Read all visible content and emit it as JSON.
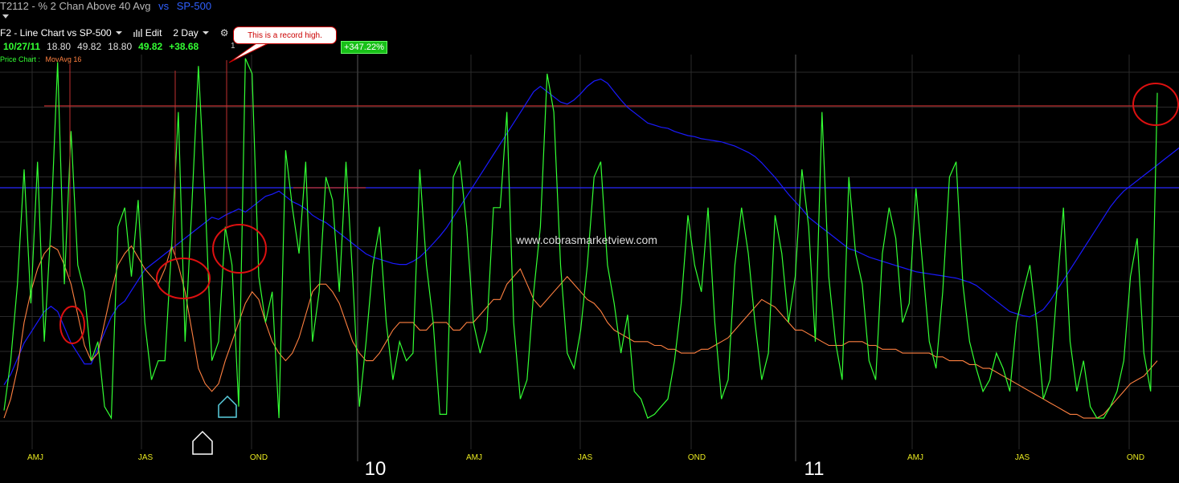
{
  "header": {
    "symbol": "T2112",
    "title": "- % 2 Chan Above 40 Avg",
    "vs": "vs",
    "compare": "SP-500"
  },
  "toolbar": {
    "chart_label": "F2 - Line Chart vs SP-500",
    "edit_label": "Edit",
    "period_label": "2 Day"
  },
  "callout": {
    "text": "This is a record high."
  },
  "quote": {
    "date": "10/27/11",
    "open": "18.80",
    "high": "49.82",
    "low": "18.80",
    "last": "49.82",
    "change": "+38.68",
    "marker": "1",
    "pct_change": "+347.22%"
  },
  "legend": {
    "series1": "Price Chart :",
    "series2": "MovAvg 16"
  },
  "watermark": "www.cobrasmarketview.com",
  "colors": {
    "indicator": "#33ff33",
    "movavg": "#ff8040",
    "sp500": "#1a1aff",
    "hline_red": "#c03030",
    "hline_blue": "#2828ff",
    "circle": "#dd1010",
    "grid": "#2a2a2a",
    "month_label": "#e8e820"
  },
  "chart_data": {
    "type": "line",
    "x_labels": [
      "AMJ",
      "JAS",
      "OND",
      "10",
      "AMJ",
      "JAS",
      "OND",
      "11",
      "AMJ",
      "JAS",
      "OND"
    ],
    "year_labels": [
      "10",
      "11"
    ],
    "series": [
      {
        "name": "% 2 Chan Above 40 Avg",
        "values": [
          7,
          20,
          40,
          70,
          35,
          72,
          25,
          55,
          98,
          40,
          80,
          45,
          38,
          20,
          25,
          8,
          5,
          55,
          60,
          42,
          62,
          30,
          15,
          20,
          20,
          50,
          85,
          25,
          60,
          97,
          62,
          20,
          25,
          55,
          45,
          8,
          99,
          95,
          42,
          30,
          38,
          5,
          75,
          60,
          48,
          72,
          25,
          38,
          68,
          62,
          38,
          72,
          42,
          8,
          25,
          45,
          55,
          30,
          15,
          25,
          20,
          22,
          70,
          45,
          30,
          6,
          6,
          68,
          72,
          55,
          30,
          22,
          28,
          60,
          60,
          85,
          30,
          10,
          15,
          38,
          55,
          95,
          85,
          45,
          22,
          18,
          28,
          45,
          68,
          72,
          45,
          35,
          22,
          32,
          12,
          10,
          5,
          6,
          8,
          10,
          20,
          35,
          58,
          45,
          38,
          60,
          30,
          10,
          15,
          45,
          60,
          48,
          30,
          15,
          22,
          58,
          48,
          30,
          42,
          70,
          55,
          25,
          85,
          42,
          25,
          15,
          68,
          48,
          40,
          20,
          15,
          48,
          60,
          52,
          30,
          35,
          65,
          45,
          25,
          18,
          38,
          68,
          72,
          40,
          25,
          18,
          12,
          15,
          22,
          18,
          12,
          30,
          38,
          45,
          30,
          10,
          15,
          38,
          60,
          25,
          12,
          20,
          8,
          5,
          5,
          8,
          12,
          20,
          42,
          52,
          22,
          12,
          90
        ],
        "color": "#33ff33"
      },
      {
        "name": "MovAvg 16",
        "values": [
          5,
          10,
          18,
          30,
          38,
          44,
          48,
          50,
          49,
          45,
          40,
          32,
          24,
          20,
          22,
          30,
          38,
          45,
          48,
          50,
          47,
          44,
          42,
          40,
          44,
          50,
          45,
          38,
          28,
          18,
          14,
          12,
          14,
          20,
          25,
          30,
          35,
          38,
          36,
          30,
          25,
          22,
          20,
          22,
          26,
          32,
          38,
          40,
          40,
          38,
          35,
          30,
          25,
          22,
          20,
          20,
          22,
          25,
          28,
          30,
          30,
          30,
          28,
          28,
          30,
          30,
          30,
          28,
          28,
          30,
          30,
          32,
          34,
          36,
          36,
          40,
          42,
          44,
          40,
          36,
          34,
          36,
          38,
          40,
          42,
          40,
          38,
          36,
          35,
          33,
          30,
          28,
          27,
          26,
          25,
          25,
          25,
          24,
          24,
          23,
          23,
          22,
          22,
          22,
          23,
          23,
          24,
          25,
          26,
          28,
          30,
          32,
          34,
          36,
          35,
          34,
          32,
          30,
          28,
          28,
          27,
          26,
          25,
          24,
          24,
          24,
          25,
          25,
          25,
          24,
          24,
          23,
          23,
          23,
          22,
          22,
          22,
          22,
          22,
          21,
          21,
          20,
          20,
          20,
          19,
          19,
          18,
          18,
          17,
          16,
          15,
          14,
          13,
          12,
          11,
          10,
          9,
          8,
          7,
          6,
          6,
          5,
          5,
          5,
          6,
          8,
          10,
          12,
          14,
          15,
          16,
          18,
          20
        ],
        "color": "#ff8040"
      },
      {
        "name": "SP-500",
        "values": [
          1050,
          1060,
          1075,
          1090,
          1100,
          1110,
          1120,
          1125,
          1120,
          1105,
          1090,
          1080,
          1070,
          1070,
          1085,
          1100,
          1115,
          1125,
          1130,
          1140,
          1150,
          1160,
          1165,
          1170,
          1175,
          1180,
          1185,
          1190,
          1195,
          1200,
          1205,
          1210,
          1208,
          1212,
          1215,
          1218,
          1215,
          1220,
          1225,
          1230,
          1232,
          1235,
          1230,
          1225,
          1222,
          1218,
          1212,
          1208,
          1205,
          1200,
          1195,
          1190,
          1185,
          1180,
          1175,
          1172,
          1170,
          1168,
          1166,
          1165,
          1165,
          1168,
          1172,
          1178,
          1185,
          1192,
          1200,
          1210,
          1220,
          1230,
          1240,
          1250,
          1260,
          1270,
          1280,
          1290,
          1300,
          1310,
          1320,
          1330,
          1335,
          1330,
          1325,
          1320,
          1318,
          1322,
          1328,
          1335,
          1340,
          1342,
          1338,
          1330,
          1322,
          1315,
          1310,
          1305,
          1300,
          1298,
          1296,
          1295,
          1292,
          1290,
          1288,
          1287,
          1285,
          1284,
          1283,
          1282,
          1280,
          1278,
          1275,
          1272,
          1268,
          1262,
          1255,
          1248,
          1240,
          1232,
          1225,
          1218,
          1210,
          1205,
          1200,
          1195,
          1190,
          1185,
          1180,
          1178,
          1175,
          1172,
          1170,
          1168,
          1166,
          1164,
          1162,
          1160,
          1158,
          1157,
          1156,
          1155,
          1154,
          1153,
          1152,
          1150,
          1148,
          1145,
          1140,
          1135,
          1130,
          1125,
          1120,
          1118,
          1116,
          1115,
          1118,
          1122,
          1130,
          1140,
          1150,
          1160,
          1170,
          1180,
          1190,
          1200,
          1210,
          1220,
          1228,
          1235,
          1240,
          1245,
          1250,
          1255,
          1260,
          1265,
          1270,
          1275,
          1280
        ],
        "color": "#1a1aff"
      }
    ]
  }
}
